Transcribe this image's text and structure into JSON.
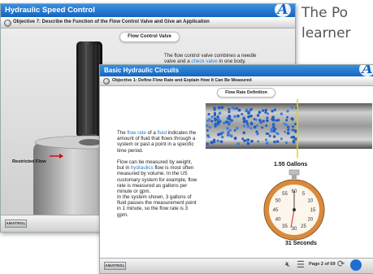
{
  "caption": {
    "text": "The Po",
    "text2": "learner"
  },
  "back_slide": {
    "title": "Hydraulic Speed Control",
    "objective": "Objective 7: Describe the Function of the Flow Control Valve and Give an Application",
    "section_title": "Flow Control Valve",
    "para_a": "The flow control valve combines a needle valve and a ",
    "para_link": "check valve",
    "para_b": " in one body.",
    "callout": "Restricted Flow",
    "logo_badge": "AMATROL",
    "logo_letter": "A"
  },
  "front_slide": {
    "title": "Basic Hydraulic Circuits",
    "objective": "Objective 1: Define Flow Rate and Explain How It Can Be Measured",
    "section_title": "Flow Rate Definition",
    "p1_a": "The ",
    "p1_link": "flow rate",
    "p1_b": " of a ",
    "p1_link2": "fluid",
    "p1_c": " indicates the amount of fluid that flows through a system or past a point in a specific time period.",
    "p2_a": "Flow can be measured by weight, but in ",
    "p2_link": "hydraulics",
    "p2_b": " flow is most often measured by volume. In the US customary system for example, flow rate is measured as gallons per minute or gpm.",
    "p3": "In the system shown, 3 gallons of fluid passes the measurement point in 1 minute, so the flow rate is 3 gpm.",
    "gallons_label": "1.55  Gallons",
    "seconds_label": "31  Seconds",
    "stopwatch_numbers": [
      "60",
      "5",
      "10",
      "15",
      "20",
      "25",
      "30",
      "35",
      "40",
      "45",
      "50",
      "55"
    ],
    "page_indicator": "Page 2 of 69",
    "logo_badge": "AMATROL",
    "logo_letter": "A"
  },
  "colors": {
    "title_blue": "#1565c0",
    "link_blue": "#2a78c8",
    "stopwatch_orange": "#d98a3c",
    "fluid_blue": "#1f5fc2"
  }
}
